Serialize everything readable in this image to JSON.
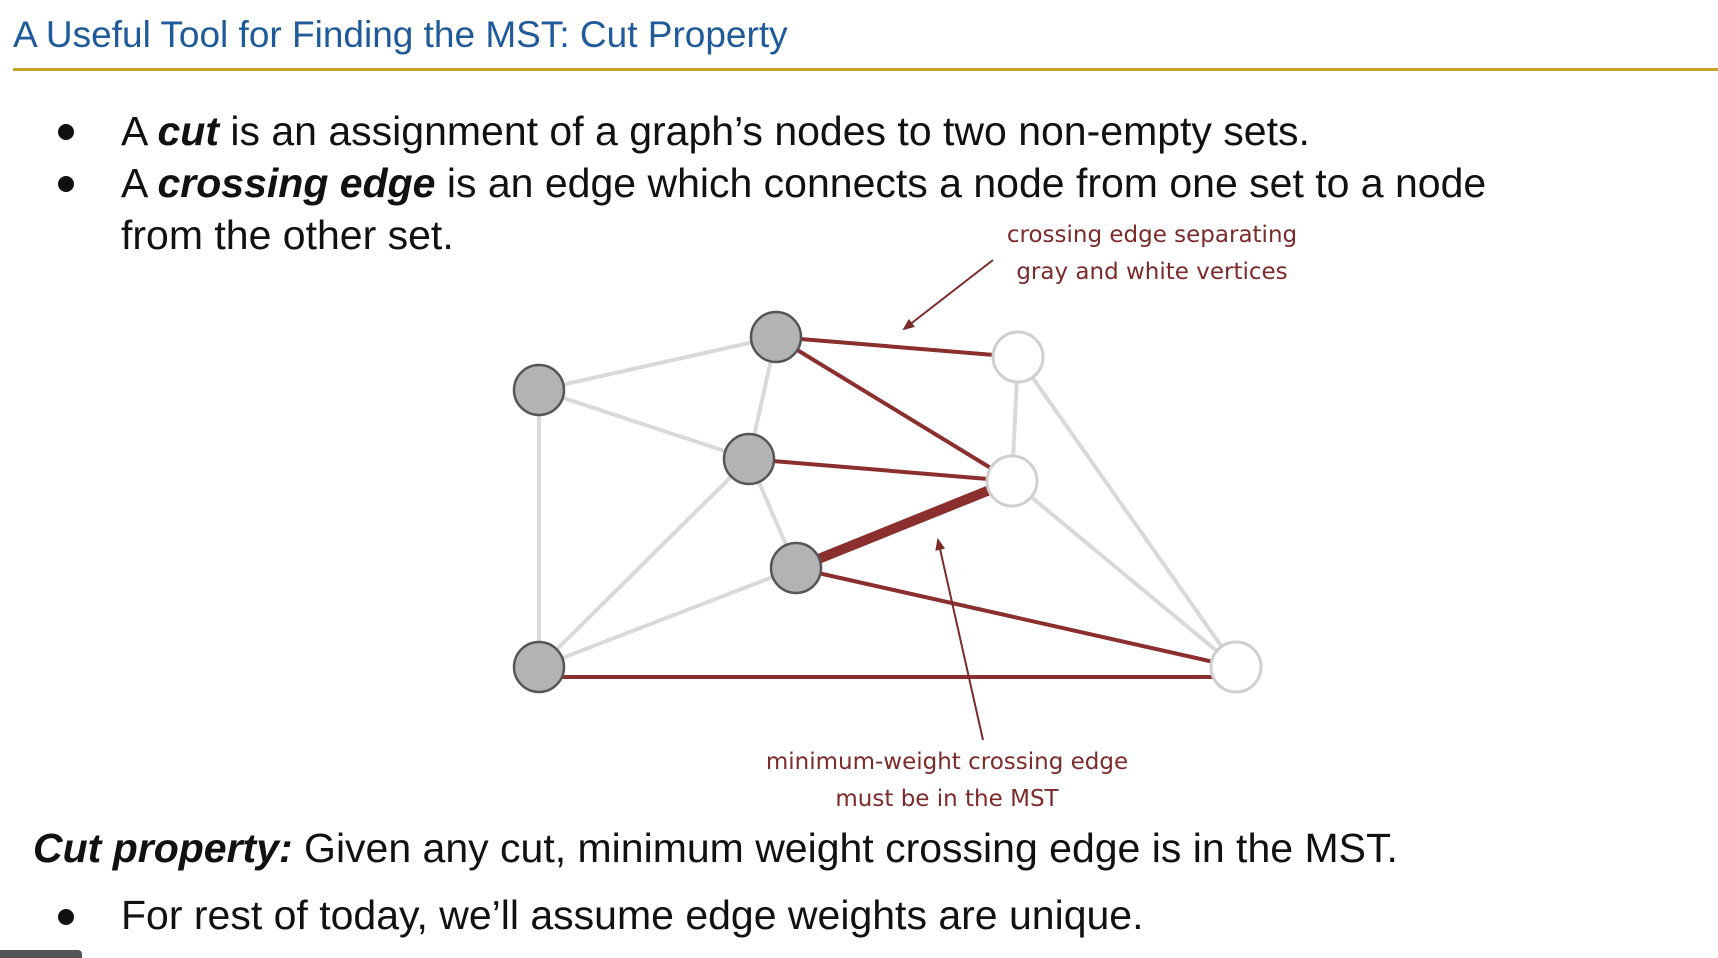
{
  "slide": {
    "title": "A Useful Tool for Finding the MST: Cut Property"
  },
  "bullets": [
    {
      "pre": "A ",
      "term": "cut",
      "rest": " is an assignment of a graph’s nodes to two non-empty sets."
    },
    {
      "pre": "A ",
      "term": "crossing edge",
      "rest": " is an edge which connects a node from one set to a node",
      "cont": "from the other set."
    }
  ],
  "diagram": {
    "annotation_top": [
      "crossing edge separating",
      "gray and white vertices"
    ],
    "annotation_bottom": [
      "minimum-weight crossing edge",
      "must be in the MST"
    ],
    "colors": {
      "gray_node": "#b3b3b3",
      "white_node": "#ffffff",
      "crossing_edge": "#8b2e2e",
      "plain_edge": "#d9d9d9",
      "annotation": "#7c2a2a"
    }
  },
  "cut_property": {
    "label": "Cut property:",
    "text": " Given any cut, minimum weight crossing edge is in the MST."
  },
  "footer_bullet": "For rest of today, we’ll assume edge weights are unique."
}
